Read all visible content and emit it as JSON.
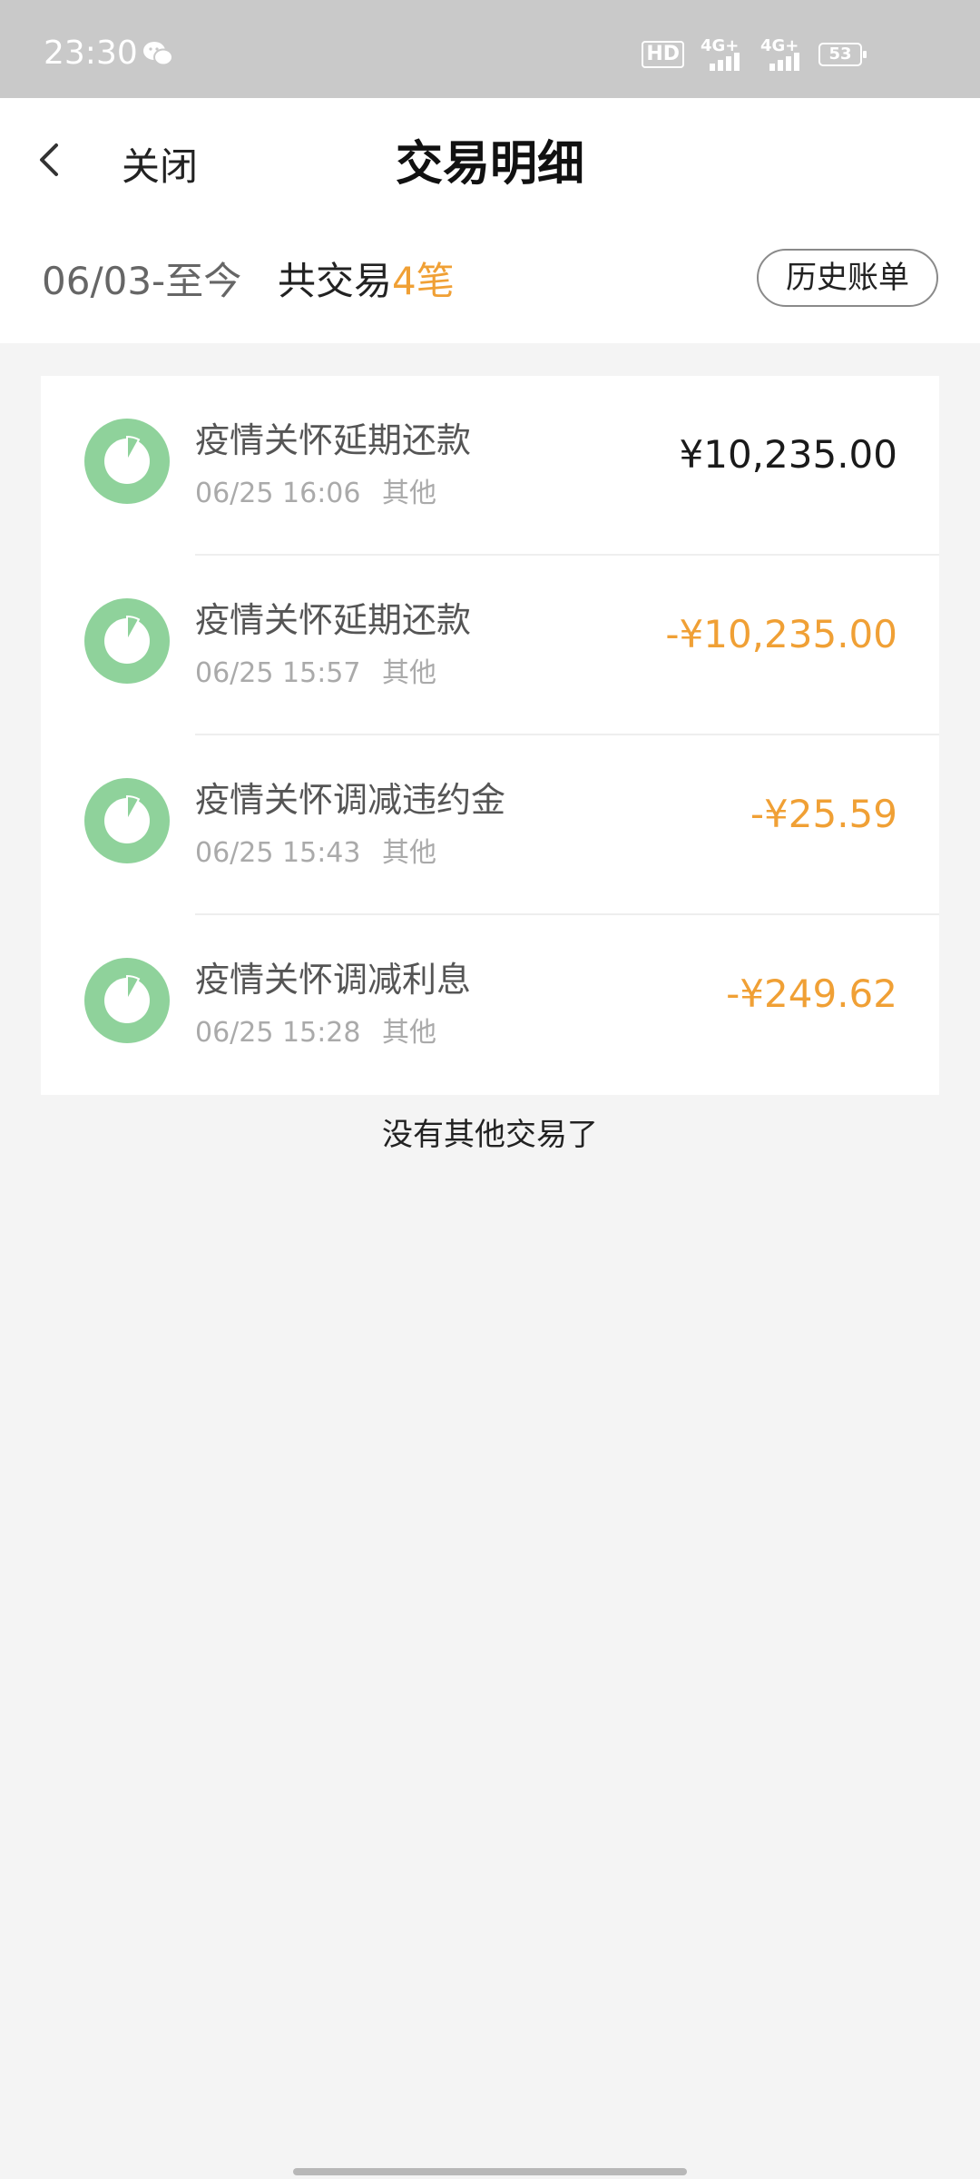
{
  "status_bar": {
    "time": "23:30",
    "hd_label": "HD",
    "network_1": "4G+",
    "network_2": "4G+",
    "battery": "53",
    "icons": [
      "wechat-icon",
      "hd-icon",
      "signal-icon",
      "signal-icon",
      "battery-icon"
    ]
  },
  "header": {
    "back_icon": "chevron-left-icon",
    "close_label": "关闭",
    "title": "交易明细"
  },
  "summary": {
    "date_range": "06/03-至今",
    "count_prefix": "共交易",
    "count_value": "4笔",
    "history_button": "历史账单"
  },
  "transactions": [
    {
      "name": "疫情关怀延期还款",
      "date": "06/25",
      "time": "16:06",
      "category": "其他",
      "amount": "¥10,235.00",
      "type": "positive"
    },
    {
      "name": "疫情关怀延期还款",
      "date": "06/25",
      "time": "15:57",
      "category": "其他",
      "amount": "-¥10,235.00",
      "type": "negative"
    },
    {
      "name": "疫情关怀调减违约金",
      "date": "06/25",
      "time": "15:43",
      "category": "其他",
      "amount": "-¥25.59",
      "type": "negative"
    },
    {
      "name": "疫情关怀调减利息",
      "date": "06/25",
      "time": "15:28",
      "category": "其他",
      "amount": "-¥249.62",
      "type": "negative"
    }
  ],
  "footer_note": "没有其他交易了",
  "colors": {
    "accent_orange": "#f0a035",
    "icon_green": "#8fd29b",
    "status_bar_bg": "#c9c9c9",
    "page_bg": "#f4f4f4"
  }
}
